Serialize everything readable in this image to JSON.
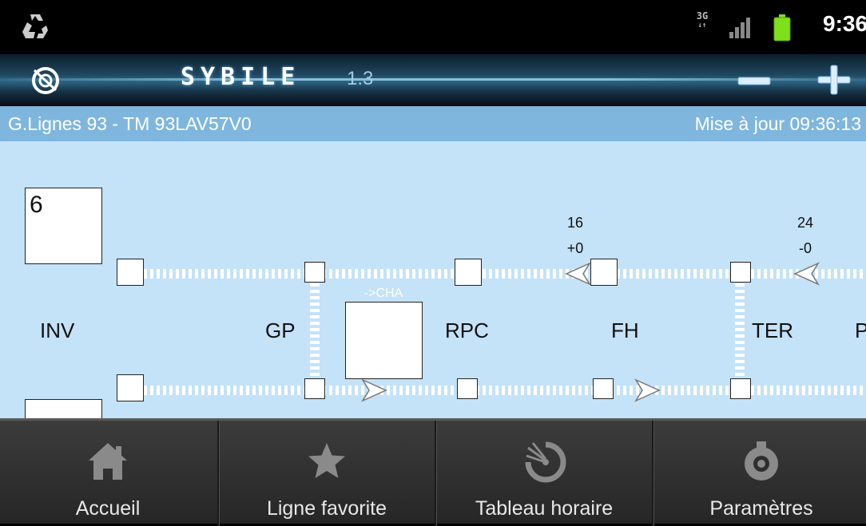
{
  "status_bar": {
    "network_label": "3G",
    "time": "9:36",
    "icons": [
      "recycle-icon",
      "signal-icon",
      "battery-icon"
    ]
  },
  "app_bar": {
    "app_name": "SYBILE",
    "version": "1.3",
    "zoom_out_icon": "minus-icon",
    "zoom_in_icon": "plus-icon"
  },
  "info_bar": {
    "line_title": "G.Lignes 93 - TM 93LAV57V0",
    "update_label": "Mise à jour 09:36:13"
  },
  "diagram": {
    "stations": [
      "INV",
      "GP",
      "RPC",
      "FH",
      "TER",
      "P"
    ],
    "top_box_value": "6",
    "destination_label": "->CHA",
    "vehicles_upper": [
      {
        "number": "16",
        "offset": "+0"
      },
      {
        "number": "24",
        "offset": "-0"
      }
    ]
  },
  "bottom_nav": {
    "items": [
      {
        "label": "Accueil",
        "icon": "home-icon"
      },
      {
        "label": "Ligne favorite",
        "icon": "star-icon"
      },
      {
        "label": "Tableau horaire",
        "icon": "schedule-clock-icon"
      },
      {
        "label": "Paramètres",
        "icon": "settings-gear-icon"
      }
    ]
  },
  "colors": {
    "status_bar_bg": "#000000",
    "info_bar_bg": "#7fb6de",
    "diagram_bg": "#c4e2f8",
    "nav_bg": "#2e2e2e",
    "battery": "#7ee01a"
  }
}
